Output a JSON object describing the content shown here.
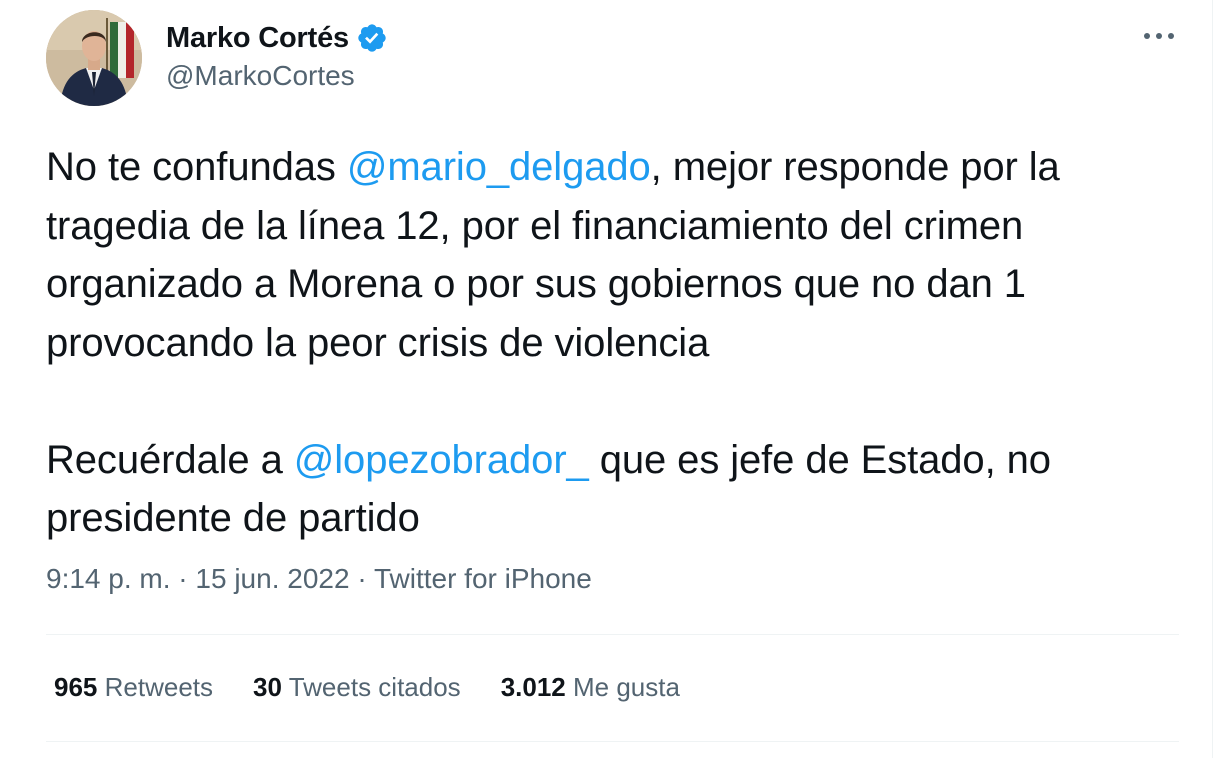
{
  "author": {
    "display_name": "Marko Cortés",
    "handle": "@MarkoCortes",
    "verified": true,
    "avatar_icon": "profile-photo"
  },
  "tweet": {
    "paragraph1": [
      {
        "text": "No te confundas ",
        "mention": false
      },
      {
        "text": "@mario_delgado",
        "mention": true
      },
      {
        "text": ", mejor responde por la tragedia de la línea 12, por el financiamiento del crimen organizado a Morena o por sus gobiernos que no dan 1 provocando la peor crisis de violencia",
        "mention": false
      }
    ],
    "paragraph2": [
      {
        "text": "Recuérdale a ",
        "mention": false
      },
      {
        "text": "@lopezobrador_",
        "mention": true
      },
      {
        "text": " que es jefe de Estado, no presidente de partido",
        "mention": false
      }
    ]
  },
  "meta": {
    "time": "9:14 p. m.",
    "separator": " · ",
    "date": "15 jun. 2022",
    "source": "Twitter for iPhone"
  },
  "stats": {
    "retweets_count": "965",
    "retweets_label": "Retweets",
    "quotes_count": "30",
    "quotes_label": "Tweets citados",
    "likes_count": "3.012",
    "likes_label": "Me gusta"
  },
  "colors": {
    "link": "#1d9bf0",
    "text": "#0f1419",
    "secondary": "#536471",
    "divider": "#eff3f4"
  }
}
